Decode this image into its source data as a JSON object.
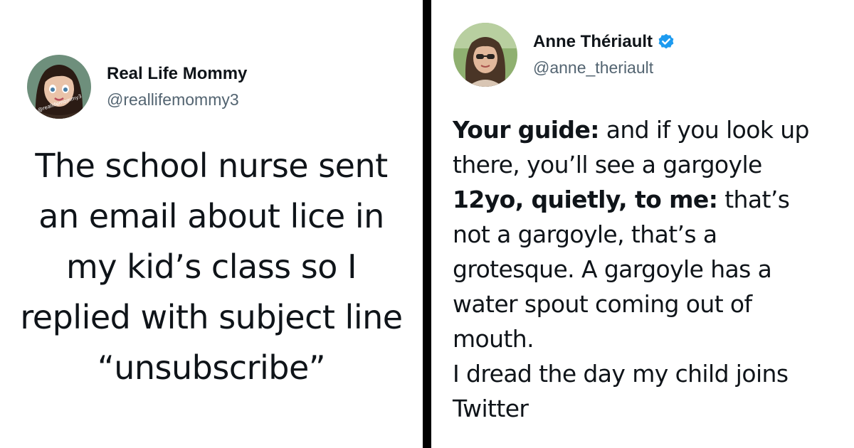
{
  "left_tweet": {
    "display_name": "Real Life Mommy",
    "handle": "@reallifemommy3",
    "avatar_icon": "cartoon-woman-avatar-icon",
    "text": "The school nurse sent an email about lice in my kid’s class so I replied with subject line “unsubscribe”"
  },
  "right_tweet": {
    "display_name": "Anne Thériault",
    "handle": "@anne_theriault",
    "verified_icon": "verified-badge-icon",
    "verified_color": "#1d9bf0",
    "avatar_icon": "woman-sunglasses-photo-avatar-icon",
    "line1_bold": "Your guide:",
    "line1_rest": " and if you look up",
    "line2": "there, you’ll see a gargoyle",
    "line3_bold": "12yo, quietly, to me:",
    "line3_rest": " that’s",
    "line4": "not a gargoyle, that’s a",
    "line5": "grotesque. A gargoyle has a",
    "line6": "water spout coming out of",
    "line7": "mouth.",
    "line8": "I dread the day my child joins",
    "line9": "Twitter"
  },
  "colors": {
    "text_primary": "#0f1419",
    "text_secondary": "#536471",
    "divider": "#000000",
    "background": "#ffffff"
  }
}
